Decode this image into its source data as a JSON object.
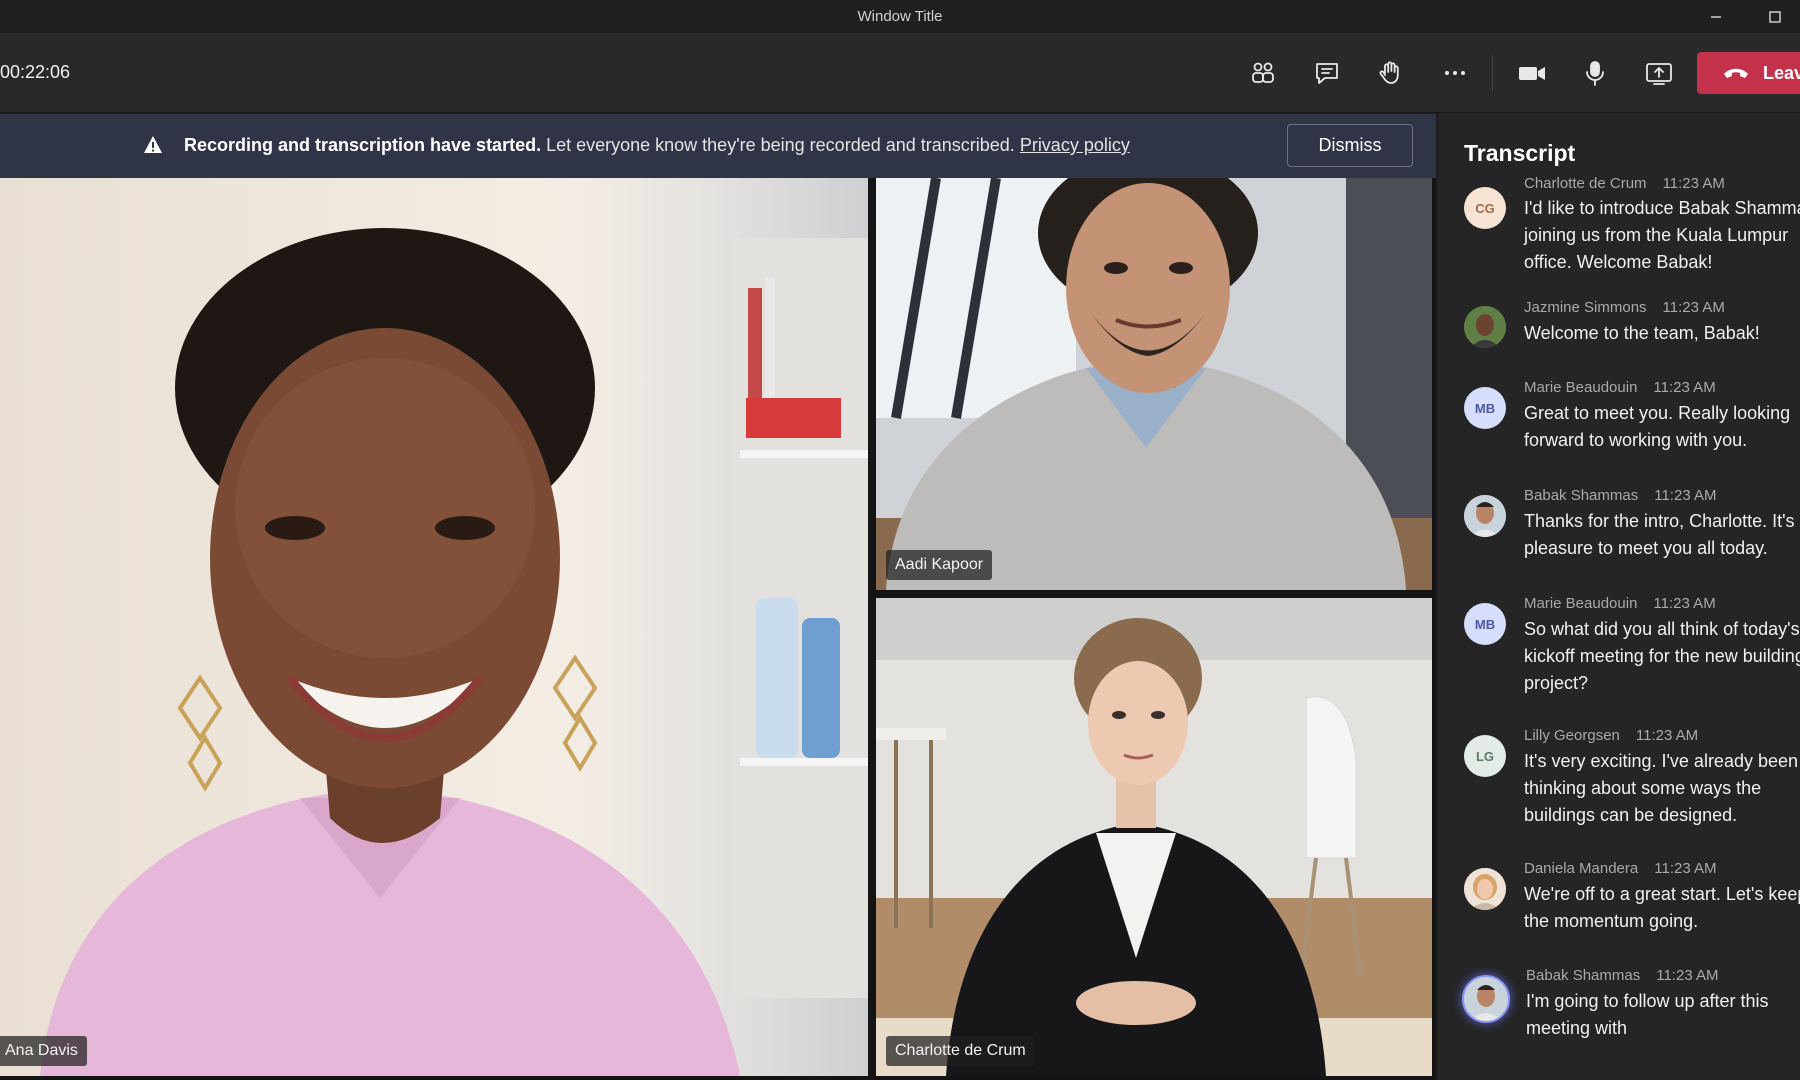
{
  "window": {
    "title": "Window Title"
  },
  "toolbar": {
    "timer": "00:22:06",
    "leave_label": "Leave",
    "colors": {
      "leave": "#c4314b"
    }
  },
  "banner": {
    "bold_text": "Recording and transcription have started.",
    "text": " Let everyone know they're being recorded and transcribed. ",
    "link": "Privacy policy",
    "dismiss_label": "Dismiss"
  },
  "videos": [
    {
      "name": "Ana Davis"
    },
    {
      "name": "Aadi Kapoor"
    },
    {
      "name": "Charlotte de Crum"
    }
  ],
  "transcript": {
    "title": "Transcript",
    "entries": [
      {
        "initials": "CG",
        "name": "Charlotte de Crum",
        "time": "11:23 AM",
        "text": "I'd like to introduce Babak Shammas joining us from the Kuala Lumpur office. Welcome Babak!"
      },
      {
        "initials": "",
        "name": "Jazmine Simmons",
        "time": "11:23 AM",
        "text": "Welcome to the team, Babak!"
      },
      {
        "initials": "MB",
        "name": "Marie Beaudouin",
        "time": "11:23 AM",
        "text": "Great to meet you. Really looking forward to working with you."
      },
      {
        "initials": "",
        "name": "Babak Shammas",
        "time": "11:23 AM",
        "text": "Thanks for the intro, Charlotte. It's a pleasure to meet you all today."
      },
      {
        "initials": "MB",
        "name": "Marie Beaudouin",
        "time": "11:23 AM",
        "text": "So what did you all think of today's kickoff meeting for the new building project?"
      },
      {
        "initials": "LG",
        "name": "Lilly Georgsen",
        "time": "11:23 AM",
        "text": "It's very exciting. I've already been thinking about some ways the buildings can be designed."
      },
      {
        "initials": "",
        "name": "Daniela Mandera",
        "time": "11:23 AM",
        "text": "We're off to a great start. Let's keep the momentum going."
      },
      {
        "initials": "",
        "name": "Babak Shammas",
        "time": "11:23 AM",
        "text": "I'm going to follow up after this meeting with"
      }
    ]
  }
}
